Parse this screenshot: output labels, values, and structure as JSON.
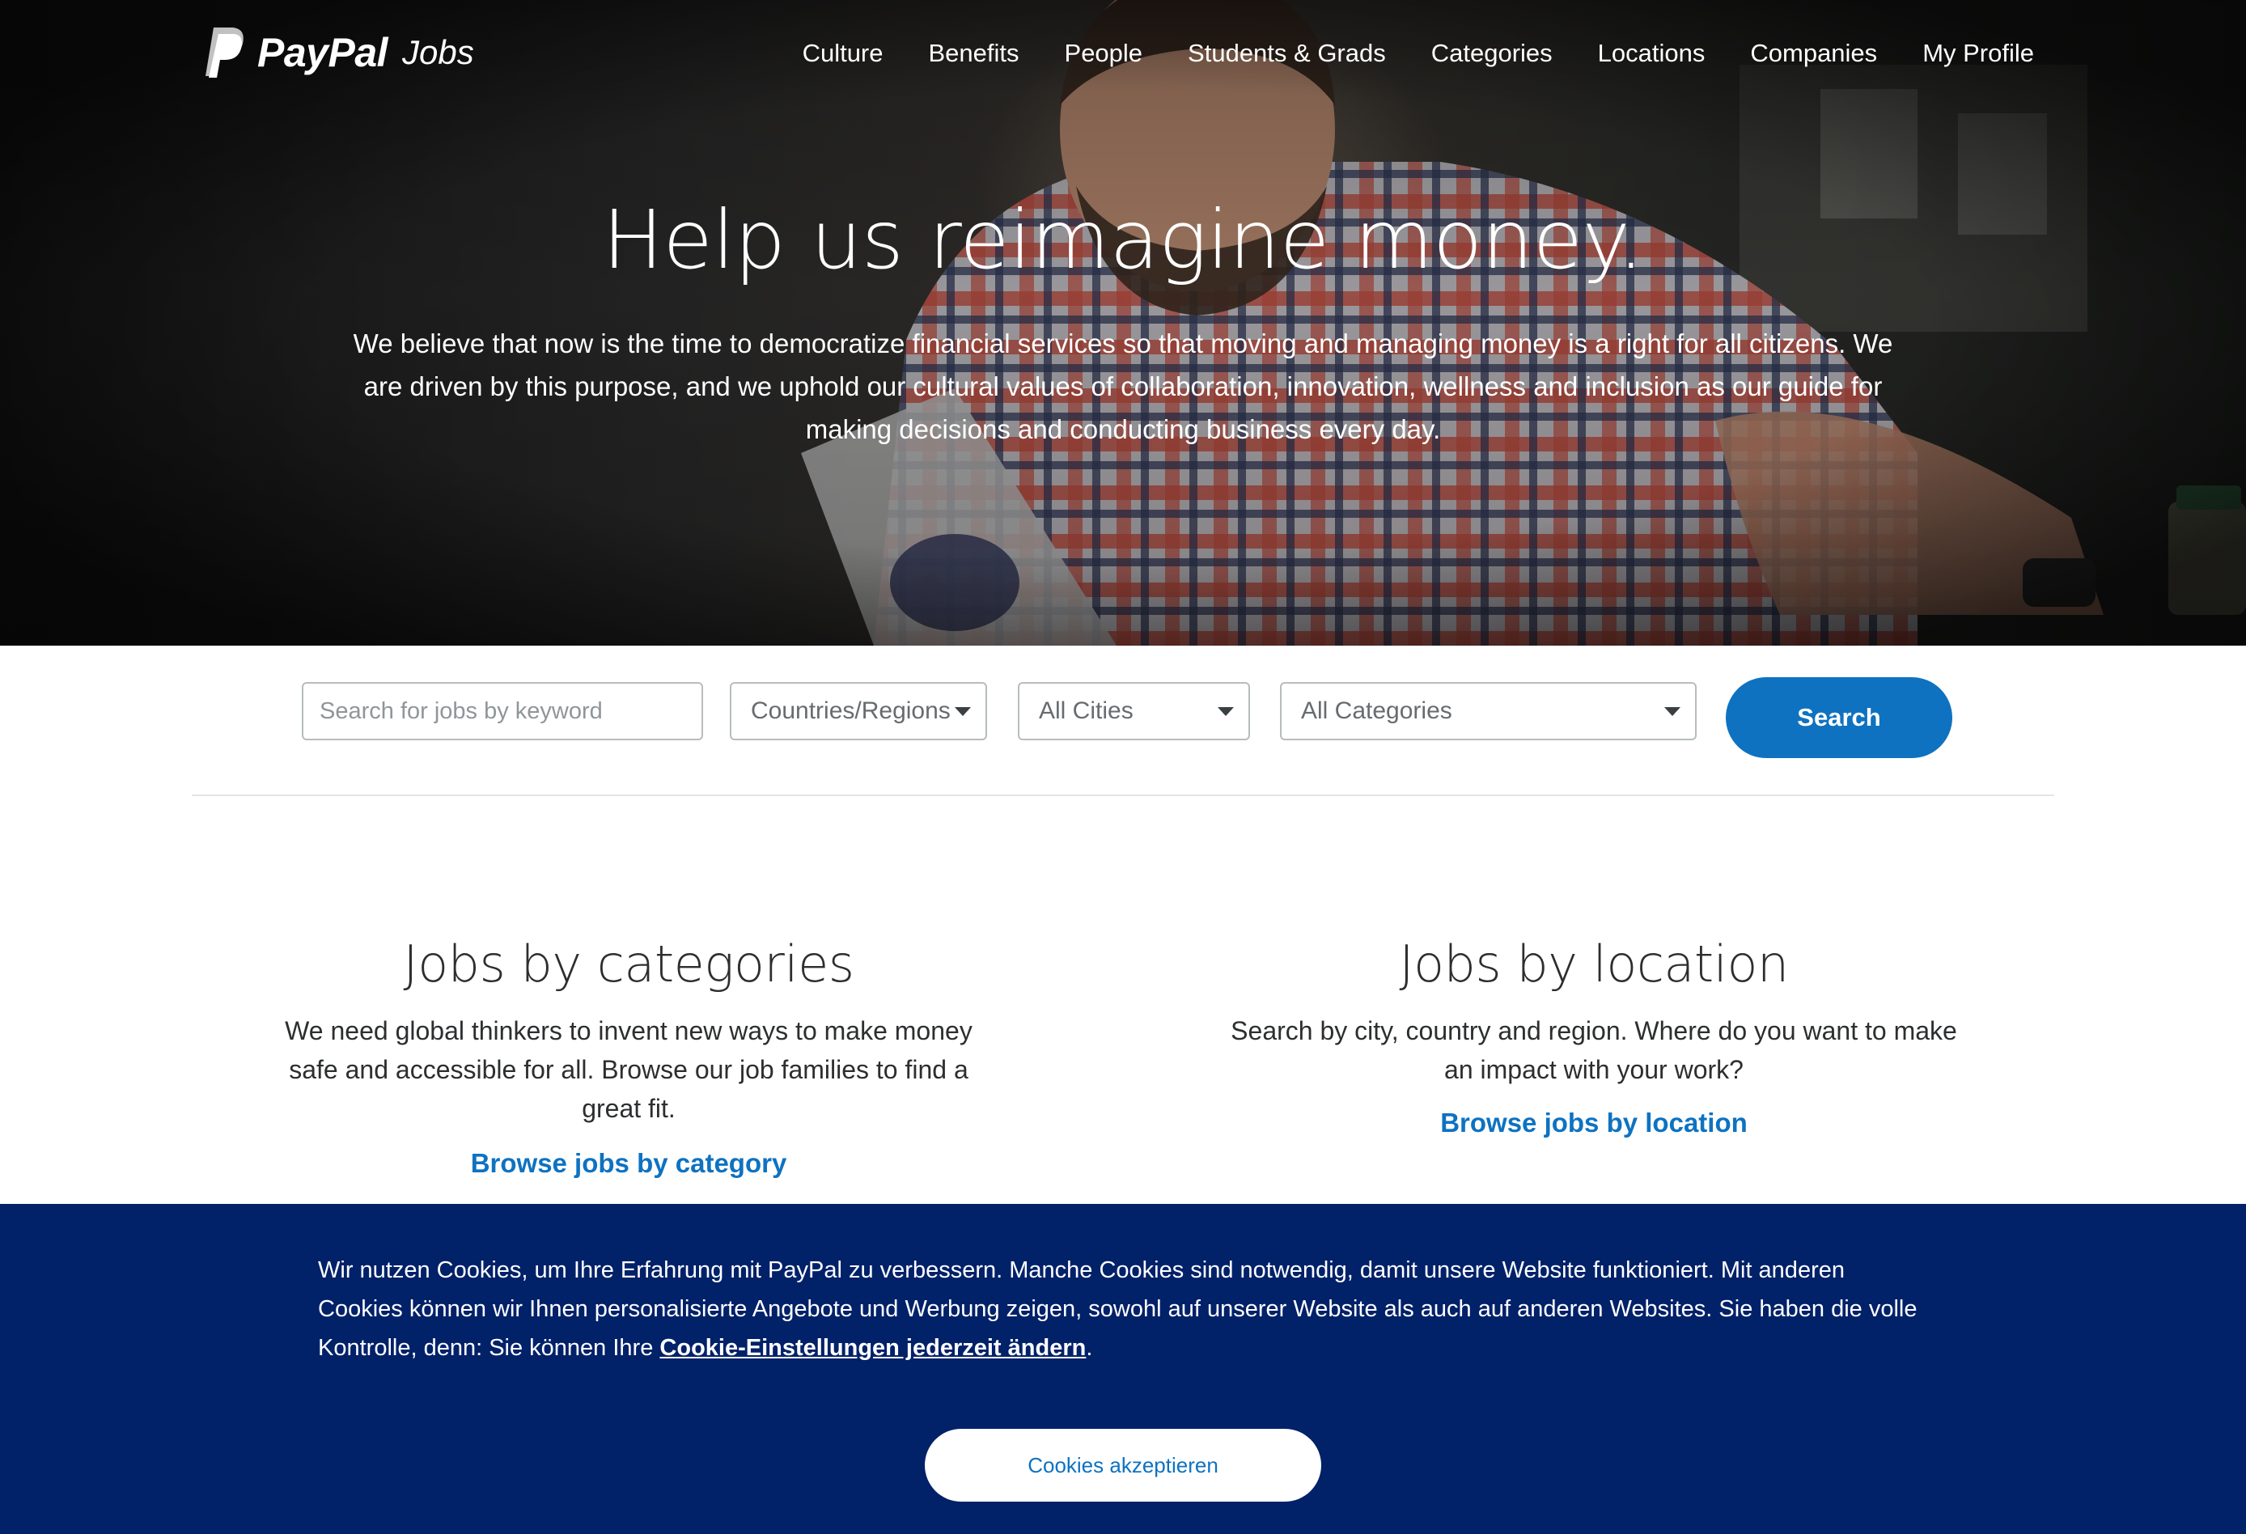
{
  "brand": {
    "name": "PayPal",
    "product": "Jobs"
  },
  "nav": {
    "items": [
      {
        "label": "Culture"
      },
      {
        "label": "Benefits"
      },
      {
        "label": "People"
      },
      {
        "label": "Students & Grads"
      },
      {
        "label": "Categories"
      },
      {
        "label": "Locations"
      },
      {
        "label": "Companies"
      },
      {
        "label": "My Profile"
      }
    ]
  },
  "hero": {
    "title": "Help us reimagine money.",
    "subtitle": "We believe that now is the time to democratize financial services so that moving and managing money is a right for all citizens. We are driven by this purpose, and we uphold our cultural values of collaboration, innovation, wellness and inclusion as our guide for making decisions and conducting business every day."
  },
  "search": {
    "keyword_placeholder": "Search for jobs by keyword",
    "keyword_value": "",
    "country_selected": "Countries/Regions",
    "city_selected": "All Cities",
    "category_selected": "All Categories",
    "button_label": "Search"
  },
  "sections": {
    "categories": {
      "title": "Jobs by categories",
      "text": "We need global thinkers to invent new ways to make money safe and accessible for all. Browse our job families to find a great fit.",
      "link": "Browse jobs by category"
    },
    "location": {
      "title": "Jobs by location",
      "text": "Search by city, country and region. Where do you want to make an impact with your work?",
      "link": "Browse jobs by location"
    }
  },
  "cookie": {
    "text": "Wir nutzen Cookies, um Ihre Erfahrung mit PayPal zu verbessern. Manche Cookies sind notwendig, damit unsere Website funktioniert. Mit anderen Cookies können wir Ihnen personalisierte Angebote und Werbung zeigen, sowohl auf unserer Website als auch auf anderen Websites. Sie haben die volle Kontrolle, denn: Sie können Ihre ",
    "link": "Cookie-Einstellungen jederzeit ändern",
    "end": ".",
    "button_label": "Cookies akzeptieren"
  },
  "colors": {
    "brand_blue": "#0e72c1",
    "cookie_banner": "#012169",
    "text": "#2c2e2f"
  },
  "icons": [
    "paypal-logo-icon",
    "chevron-down-icon"
  ]
}
